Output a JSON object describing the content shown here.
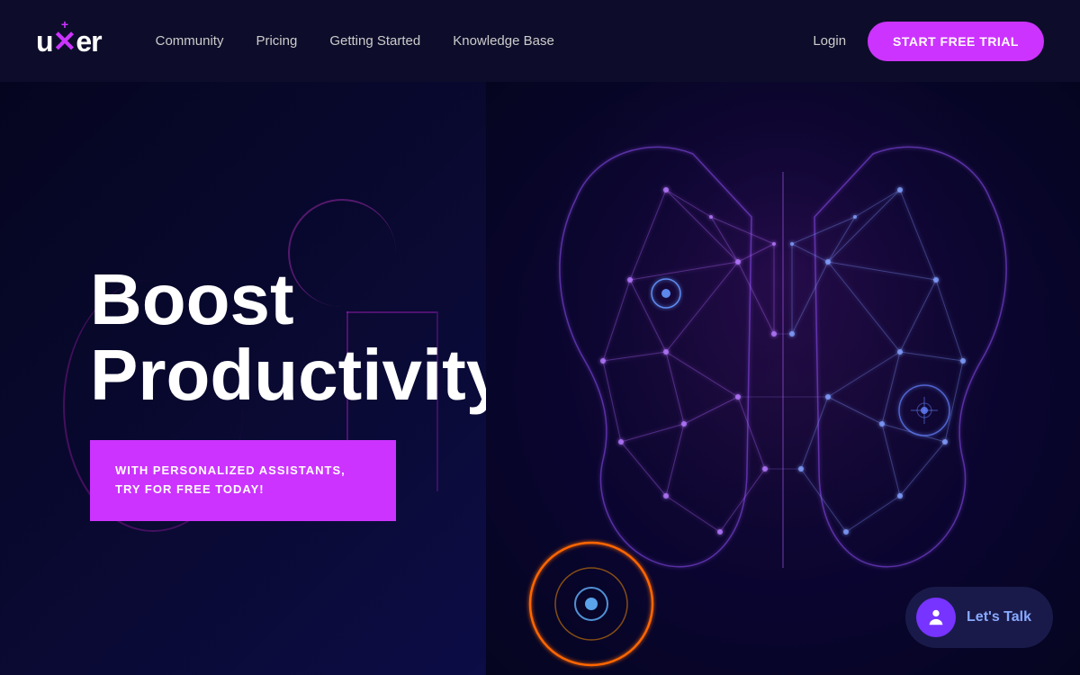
{
  "navbar": {
    "logo": "uxer",
    "links": [
      {
        "label": "Community",
        "href": "#"
      },
      {
        "label": "Pricing",
        "href": "#"
      },
      {
        "label": "Getting Started",
        "href": "#"
      },
      {
        "label": "Knowledge Base",
        "href": "#"
      }
    ],
    "login_label": "Login",
    "cta_label": "START FREE TRIAL"
  },
  "hero": {
    "title_line1": "Boost",
    "title_line2": "Productivity",
    "subtitle": "WITH PERSONALIZED ASSISTANTS, TRY FOR FREE TODAY!",
    "lets_talk_label": "Let's Talk"
  },
  "colors": {
    "accent_purple": "#cc33ff",
    "accent_blue": "#7733ff",
    "nav_bg": "#0d0d2b",
    "hero_bg": "#050520"
  }
}
